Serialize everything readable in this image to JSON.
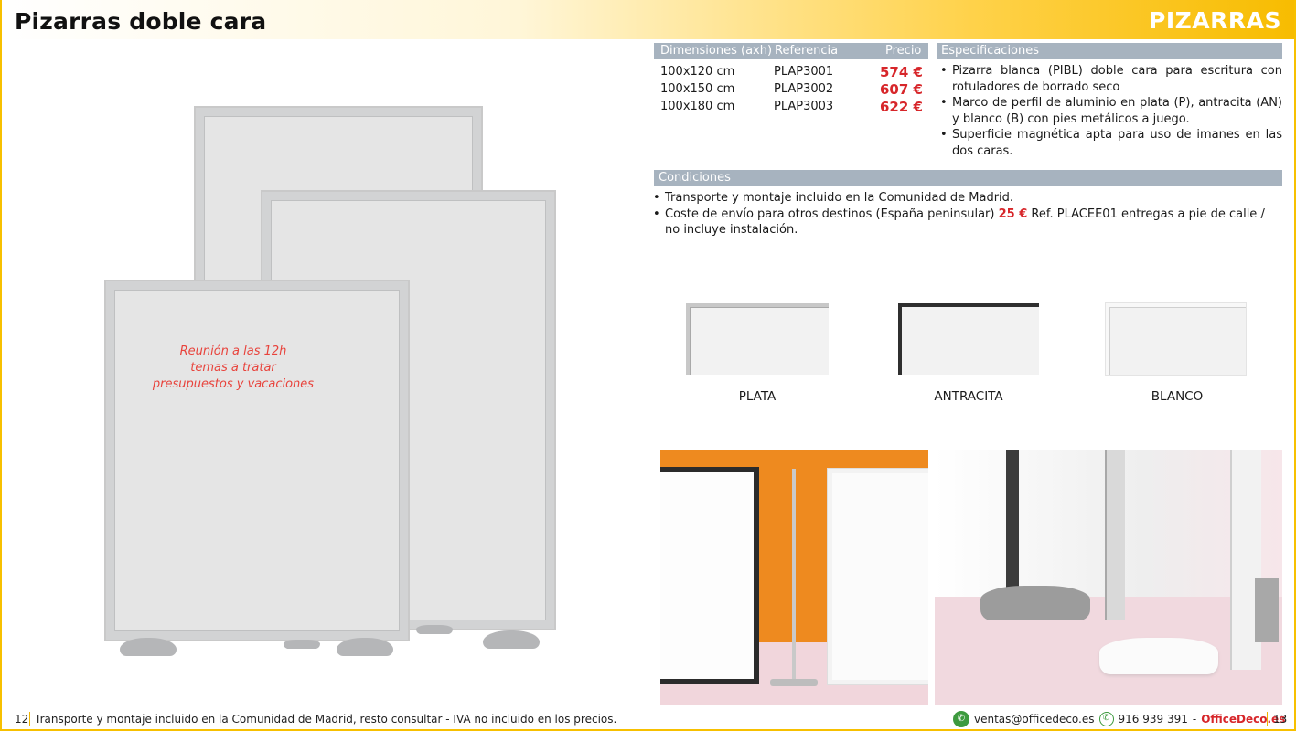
{
  "header": {
    "title": "Pizarras doble cara",
    "section": "PIZARRAS"
  },
  "illustration": {
    "board_text": [
      "Reunión a las 12h",
      "temas a tratar",
      "presupuestos y vacaciones"
    ]
  },
  "dimensions_table": {
    "headers": {
      "dim": "Dimensiones (axh)",
      "ref": "Referencia",
      "price": "Precio"
    },
    "rows": [
      {
        "dim": "100x120 cm",
        "ref": "PLAP3001",
        "price": "574 €"
      },
      {
        "dim": "100x150 cm",
        "ref": "PLAP3002",
        "price": "607 €"
      },
      {
        "dim": "100x180 cm",
        "ref": "PLAP3003",
        "price": "622 €"
      }
    ]
  },
  "specifications": {
    "heading": "Especificaciones",
    "items": [
      "Pizarra blanca (PIBL) doble cara para escritura con rotuladores de borrado seco",
      "Marco de perfil de aluminio en plata (P), antracita (AN) y blanco (B) con pies metálicos a juego.",
      "Superficie magnética apta para uso de imanes en las dos caras."
    ]
  },
  "conditions": {
    "heading": "Condiciones",
    "item1": "Transporte y montaje incluido en la Comunidad de Madrid.",
    "item2_before": "Coste de envío para otros destinos (España peninsular) ",
    "item2_price": "25 €",
    "item2_after": " Ref. PLACEE01 entregas a pie de calle / no incluye instalación."
  },
  "finishes": [
    {
      "label": "PLATA",
      "frame_color": "#c8c8c8"
    },
    {
      "label": "ANTRACITA",
      "frame_color": "#2f2f2f"
    },
    {
      "label": "BLANCO",
      "frame_color": "#f4f4f4"
    }
  ],
  "footer": {
    "page_left": "12",
    "note": "Transporte y montaje incluido en la Comunidad de Madrid, resto consultar - IVA no incluido en los precios.",
    "email": "ventas@officedeco.es",
    "phone": "916 939 391",
    "dash": "-",
    "brand": "OfficeDeco.es",
    "page_right": "13"
  },
  "colors": {
    "accent": "#f7c000",
    "price_red": "#d7262a",
    "table_header": "#a7b3bf"
  }
}
